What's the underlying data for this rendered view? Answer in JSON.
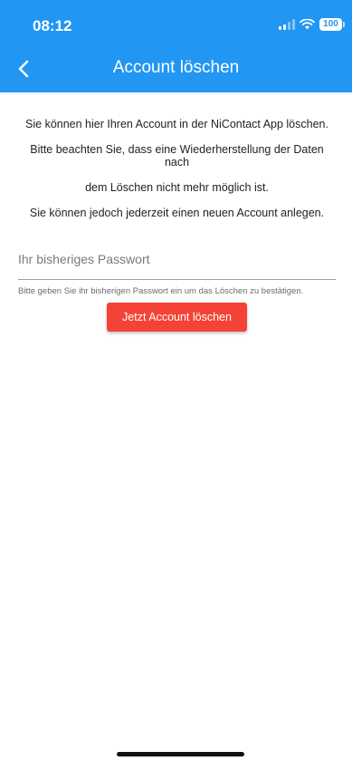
{
  "status_bar": {
    "time": "08:12",
    "battery": "100"
  },
  "app_bar": {
    "title": "Account löschen",
    "back_icon": "chevron-left-icon"
  },
  "info": {
    "line1": "Sie können hier Ihren Account in der NiContact App löschen.",
    "line2": "Bitte beachten Sie, dass eine Wiederherstellung der Daten nach",
    "line3": "dem Löschen nicht mehr möglich ist.",
    "line4": "Sie können jedoch jederzeit einen neuen Account anlegen."
  },
  "password_field": {
    "placeholder": "Ihr bisheriges Passwort",
    "value": ""
  },
  "helper_text": "Bitte geben Sie ihr bisherigen Passwort ein um das Löschen zu bestätigen.",
  "delete_button_label": "Jetzt Account löschen",
  "colors": {
    "primary": "#2196f3",
    "danger": "#f44336"
  }
}
